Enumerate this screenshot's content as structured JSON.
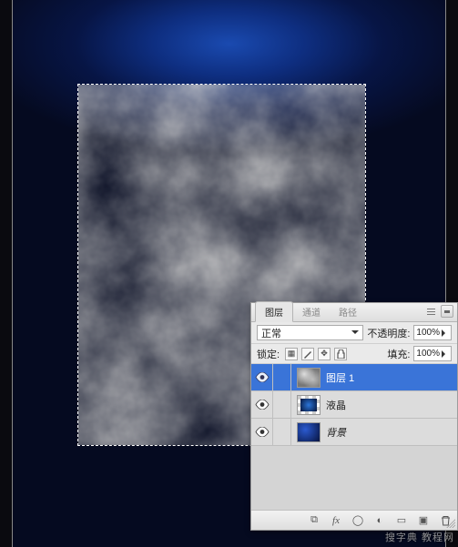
{
  "watermark_text": "搜字典 教程网",
  "panel": {
    "tabs": {
      "layers": "图层",
      "channels": "通道",
      "paths": "路径"
    },
    "blend_mode_value": "正常",
    "opacity_label": "不透明度:",
    "opacity_value": "100%",
    "lock_label": "锁定:",
    "fill_label": "填充:",
    "fill_value": "100%",
    "layers": [
      {
        "name": "图层 1",
        "italic": false,
        "selected": true,
        "thumb": "clouds"
      },
      {
        "name": "液晶",
        "italic": false,
        "selected": false,
        "thumb": "crystal"
      },
      {
        "name": "背景",
        "italic": true,
        "selected": false,
        "thumb": "bg"
      }
    ]
  }
}
